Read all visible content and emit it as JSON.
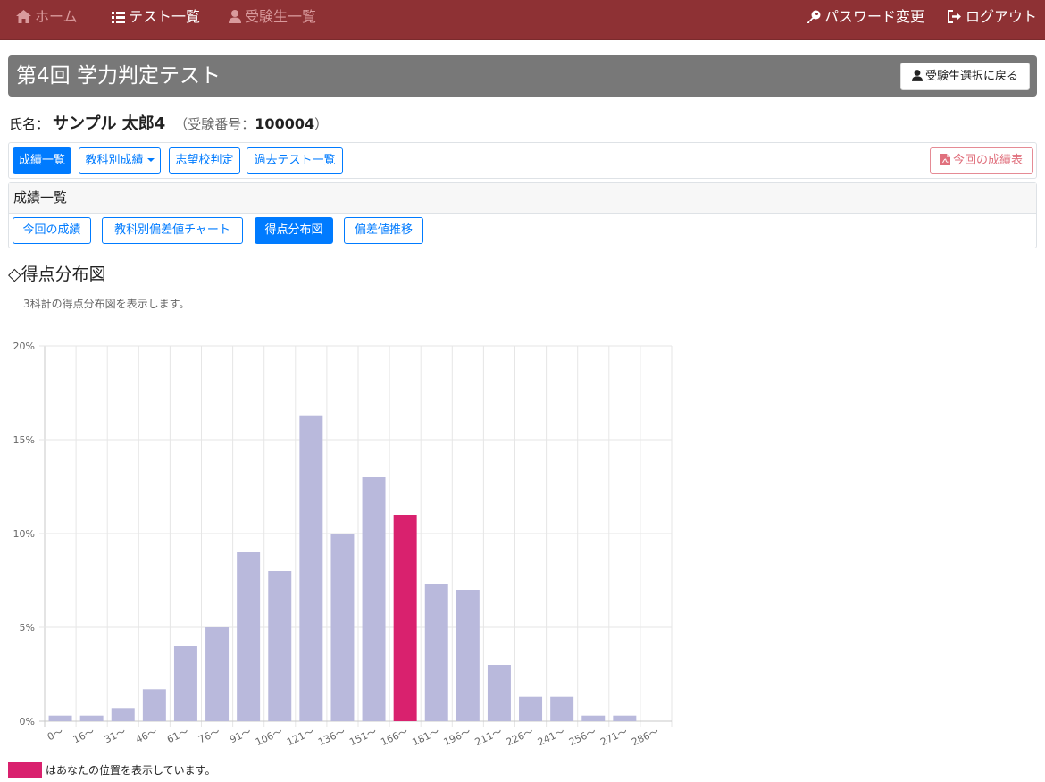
{
  "nav": {
    "home": "ホーム",
    "tests": "テスト一覧",
    "students": "受験生一覧",
    "password": "パスワード変更",
    "logout": "ログアウト"
  },
  "page": {
    "title": "第4回 学力判定テスト",
    "back_button": "受験生選択に戻る"
  },
  "student": {
    "name_label": "氏名：",
    "name": "サンプル 太郎4",
    "number_prefix": "（受験番号：",
    "number": "100004",
    "number_suffix": "）"
  },
  "tabs": {
    "results": "成績一覧",
    "by_subject": "教科別成績",
    "school": "志望校判定",
    "past": "過去テスト一覧",
    "report": "今回の成績表"
  },
  "subpanel": {
    "header": "成績一覧",
    "current": "今回の成績",
    "deviation_chart": "教科別偏差値チャート",
    "distribution": "得点分布図",
    "trend": "偏差値推移"
  },
  "section": {
    "title": "◇得点分布図",
    "description": "3科計の得点分布図を表示します。"
  },
  "chart_data": {
    "type": "bar",
    "categories": [
      "0～",
      "16～",
      "31～",
      "46～",
      "61～",
      "76～",
      "91～",
      "106～",
      "121～",
      "136～",
      "151～",
      "166～",
      "181～",
      "196～",
      "211～",
      "226～",
      "241～",
      "256～",
      "271～",
      "286～"
    ],
    "values": [
      0.3,
      0.3,
      0.7,
      1.7,
      4.0,
      5.0,
      9.0,
      8.0,
      16.3,
      10.0,
      13.0,
      11.0,
      7.3,
      7.0,
      3.0,
      1.3,
      1.3,
      0.3,
      0.3,
      0
    ],
    "highlight_index": 11,
    "ylim": [
      0,
      20
    ],
    "yticks": [
      "0%",
      "5%",
      "10%",
      "15%",
      "20%"
    ],
    "colors": {
      "bar": "#b9b9dc",
      "highlight": "#d9216e"
    },
    "grid": true
  },
  "legend": {
    "text": "はあなたの位置を表示しています。",
    "color": "#d9216e"
  }
}
